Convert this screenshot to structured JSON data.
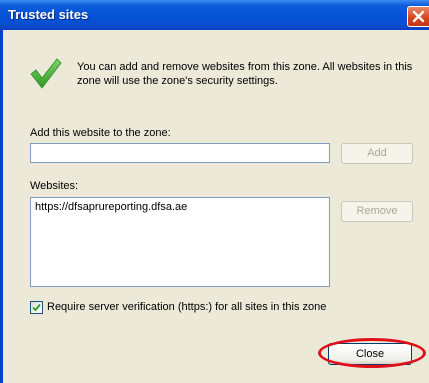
{
  "window": {
    "title": "Trusted sites"
  },
  "info": {
    "text": "You can add and remove websites from this zone. All websites in this zone will use the zone's security settings."
  },
  "add_section": {
    "label": "Add this website to the zone:",
    "input_value": "",
    "add_button": "Add"
  },
  "websites": {
    "label": "Websites:",
    "items": [
      "https://dfsaprureporting.dfsa.ae"
    ],
    "remove_button": "Remove"
  },
  "require_verification": {
    "checked": true,
    "label": "Require server verification (https:) for all sites in this zone"
  },
  "footer": {
    "close_button": "Close"
  },
  "colors": {
    "titlebar": "#0451d6",
    "dialog_bg": "#ece9d8",
    "annotation": "#e0101a"
  }
}
